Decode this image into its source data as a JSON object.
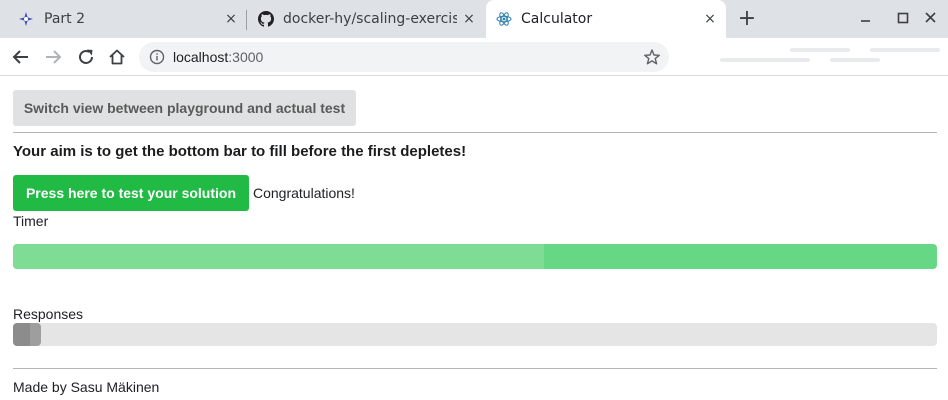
{
  "browser": {
    "tabs": [
      {
        "title": "Part 2",
        "icon": "star-burst-icon",
        "active": false
      },
      {
        "title": "docker-hy/scaling-exercise",
        "icon": "github-icon",
        "active": false
      },
      {
        "title": "Calculator",
        "icon": "react-icon",
        "active": true
      }
    ],
    "new_tab_label": "+",
    "close_glyph": "×",
    "url_host": "localhost",
    "url_port": ":3000"
  },
  "page": {
    "switch_label": "Switch view between playground and actual test",
    "aim_text": "Your aim is to get the bottom bar to fill before the first depletes!",
    "test_label": "Press here to test your solution",
    "status_text": "Congratulations!",
    "timer_label": "Timer",
    "timer_progress": 0.575,
    "responses_label": "Responses",
    "responses_progress": 0.03,
    "footer_text": "Made by Sasu Mäkinen"
  },
  "colors": {
    "accent_green": "#21ba45",
    "timer_fill": "#7edc94",
    "timer_track": "#66d784",
    "neutral_button": "#e0e1e2"
  }
}
